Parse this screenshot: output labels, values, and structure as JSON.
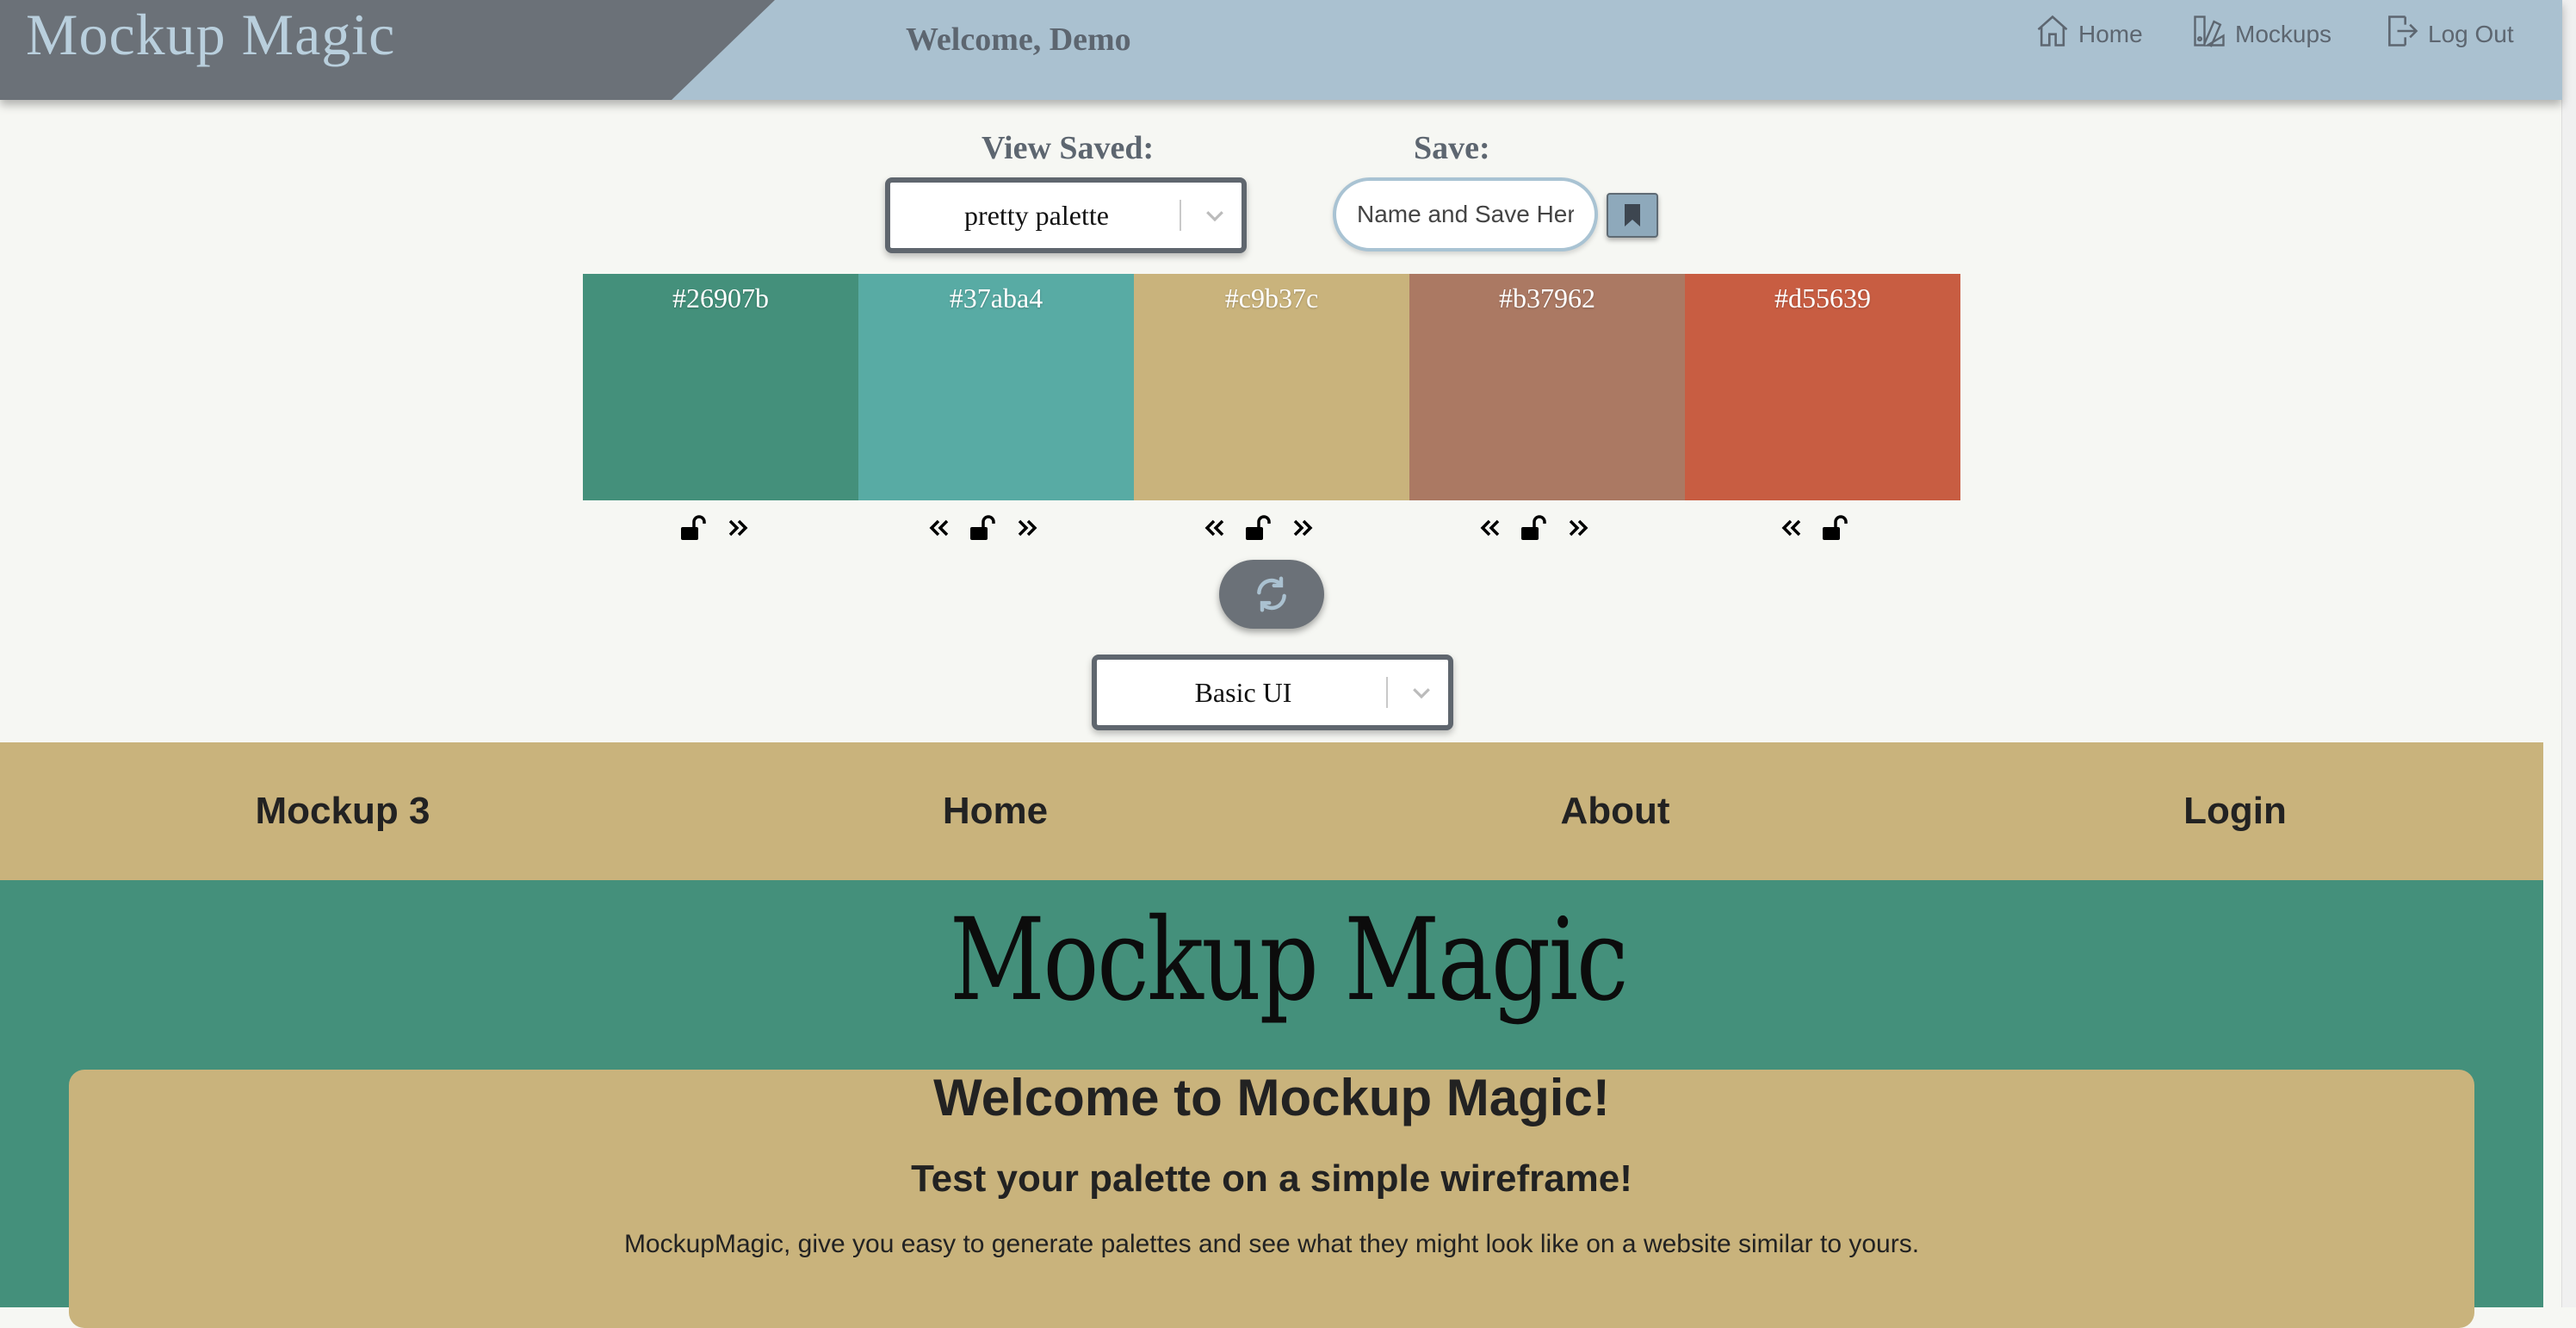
{
  "app": {
    "brand": "Mockup Magic",
    "welcome": "Welcome, Demo",
    "nav": [
      {
        "label": "Home",
        "icon": "home-icon"
      },
      {
        "label": "Mockups",
        "icon": "mockups-icon"
      },
      {
        "label": "Log Out",
        "icon": "logout-icon"
      }
    ]
  },
  "controls": {
    "view_saved_label": "View Saved:",
    "view_saved_value": "pretty palette",
    "save_label": "Save:",
    "save_placeholder": "Name and Save Here",
    "save_icon": "bookmark-icon",
    "template_value": "Basic UI",
    "refresh_icon": "refresh-icon"
  },
  "palette": {
    "swatches": [
      {
        "hex": "#26907b",
        "color": "#44907b",
        "locked": false,
        "left": false,
        "right": true
      },
      {
        "hex": "#37aba4",
        "color": "#58aba4",
        "locked": false,
        "left": true,
        "right": true
      },
      {
        "hex": "#c9b37c",
        "color": "#c9b37c",
        "locked": false,
        "left": true,
        "right": true
      },
      {
        "hex": "#b37962",
        "color": "#ab7963",
        "locked": false,
        "left": true,
        "right": true
      },
      {
        "hex": "#d55639",
        "color": "#c85d42",
        "locked": false,
        "left": true,
        "right": false
      }
    ],
    "icons": {
      "left": "chevrons-left-icon",
      "lock": "unlock-icon",
      "right": "chevrons-right-icon"
    }
  },
  "mockup": {
    "nav": [
      "Mockup 3",
      "Home",
      "About",
      "Login"
    ],
    "logo": "Mockup Magic",
    "title": "Welcome to Mockup Magic!",
    "subtitle": "Test your palette on a simple wireframe!",
    "body": "MockupMagic, give you easy to generate palettes and see what they might look like on a website similar to yours.",
    "colors": {
      "nav_bg": "#c9b37c",
      "hero_bg": "#44907b",
      "card_bg": "#c9b37c"
    }
  }
}
